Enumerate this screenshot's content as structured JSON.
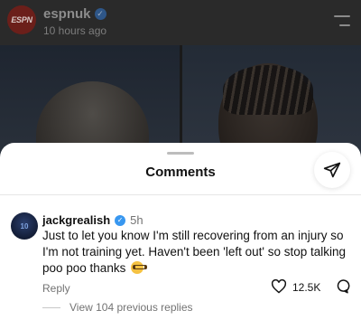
{
  "post": {
    "avatar_text": "ESPN",
    "username": "espnuk",
    "time": "10 hours ago"
  },
  "sheet": {
    "title": "Comments"
  },
  "comment": {
    "avatar_text": "10",
    "username": "jackgrealish",
    "time": "5h",
    "text": "Just to let you know I'm still recovering from an injury so I'm not training yet. Haven't been 'left out' so stop talking poo poo thanks",
    "emoji": "nerd-face-emoji",
    "reply_label": "Reply",
    "likes": "12.5K",
    "view_replies": "View 104 previous replies"
  },
  "icons": {
    "verified": "verified-badge-icon",
    "menu": "menu-icon",
    "share": "send-icon",
    "like": "heart-icon",
    "reply": "reply-bubble-icon"
  },
  "colors": {
    "verified_blue": "#3897f0",
    "sheet_bg": "#ffffff",
    "overlay_bg": "#1a1a1a"
  }
}
